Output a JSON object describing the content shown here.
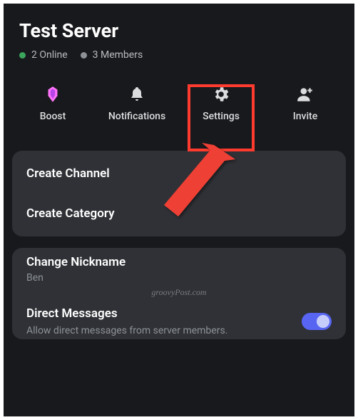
{
  "header": {
    "title": "Test Server",
    "online_text": "2 Online",
    "members_text": "3 Members"
  },
  "actions": {
    "boost": "Boost",
    "notifications": "Notifications",
    "settings": "Settings",
    "invite": "Invite"
  },
  "cards": {
    "create_channel": "Create Channel",
    "create_category": "Create Category",
    "change_nickname": "Change Nickname",
    "nickname_value": "Ben",
    "dm_title": "Direct Messages",
    "dm_desc": "Allow direct messages from server members."
  },
  "watermark": "groovyPost.com",
  "colors": {
    "highlight": "#ff3b2f",
    "accent": "#5865f2",
    "online": "#3ba55d"
  }
}
